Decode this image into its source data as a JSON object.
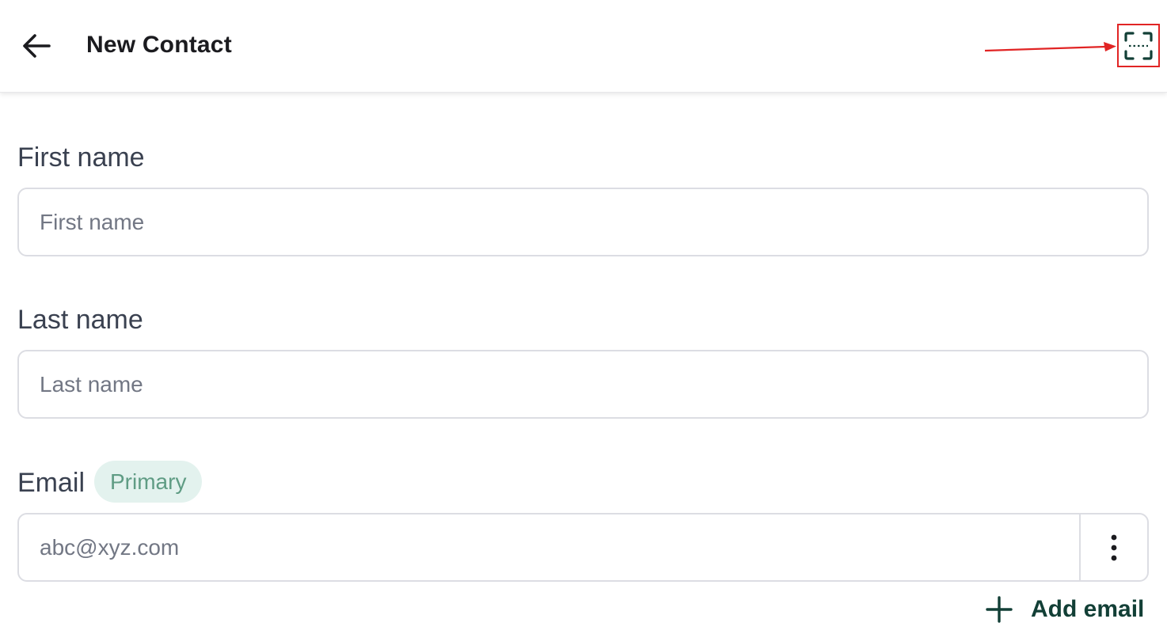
{
  "header": {
    "title": "New Contact",
    "back_icon": "arrow-left-icon",
    "scan_icon": "scan-frame-icon",
    "annotation_color": "#e12424"
  },
  "form": {
    "first_name": {
      "label": "First name",
      "placeholder": "First name"
    },
    "last_name": {
      "label": "Last name",
      "placeholder": "Last name"
    },
    "email": {
      "label": "Email",
      "badge": "Primary",
      "placeholder": "abc@xyz.com",
      "more_icon": "more-vertical-icon"
    },
    "add_email_label": "Add email"
  },
  "colors": {
    "accent": "#123f36",
    "badge_bg": "#e3f2ee",
    "badge_text": "#5f9c84"
  }
}
